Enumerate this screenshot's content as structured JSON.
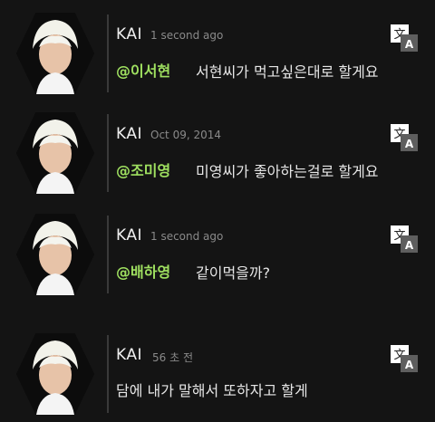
{
  "messages": [
    {
      "name": "KAI",
      "time": "1 second ago",
      "mention": "@이서현",
      "text": "서현씨가 먹고싶은대로 할게요"
    },
    {
      "name": "KAI",
      "time": "Oct 09, 2014",
      "mention": "@조미영",
      "text": "미영씨가 좋아하는걸로 할게요"
    },
    {
      "name": "KAI",
      "time": "1 second ago",
      "mention": "@배하영",
      "text": "같이먹을까?"
    },
    {
      "name": "KAI",
      "time": "56 초 전",
      "mention": "",
      "text": "담에 내가 말해서 또하자고 할게"
    }
  ],
  "colors": {
    "mention": "#9fe060",
    "background": "#141414"
  },
  "icons": {
    "translate": "translate-icon",
    "avatar": "avatar"
  }
}
